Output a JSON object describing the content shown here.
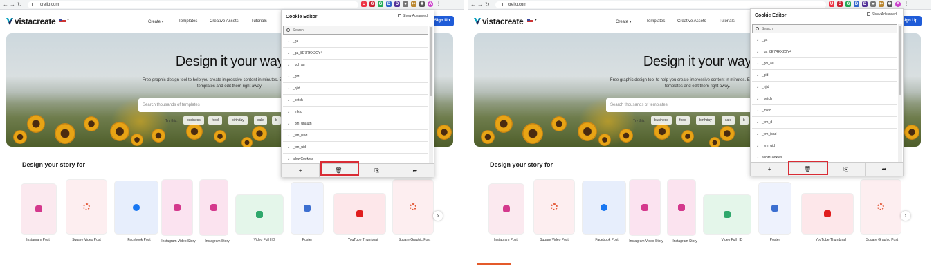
{
  "browser": {
    "url": "crello.com"
  },
  "site": {
    "logo": "vistacreate",
    "nav": [
      "Create",
      "Templates",
      "Creative Assets",
      "Tutorials"
    ],
    "signup": "Sign Up"
  },
  "hero": {
    "title": "Design it your way",
    "subtitle": "Free graphic design tool to help you create impressive content in minutes. Explore professional templates and edit them right away.",
    "search_placeholder": "Search thousands of templates",
    "try_label": "Try this:",
    "chips": [
      "business",
      "food",
      "birthday",
      "sale",
      "b"
    ]
  },
  "section": {
    "title": "Design your story for",
    "cards": [
      {
        "label": "Instagram Post",
        "icon": "instagram-icon"
      },
      {
        "label": "Square Video Post",
        "icon": "spinner-icon"
      },
      {
        "label": "Facebook Post",
        "icon": "facebook-icon"
      },
      {
        "label": "Instagram Video Story",
        "icon": "instagram-icon"
      },
      {
        "label": "Instagram Story",
        "icon": "instagram-icon"
      },
      {
        "label": "Video Full HD",
        "icon": "play-icon"
      },
      {
        "label": "Poster",
        "icon": "poster-icon"
      },
      {
        "label": "YouTube Thumbnail",
        "icon": "youtube-icon"
      },
      {
        "label": "Square Graphic Post",
        "icon": "spinner-icon"
      }
    ]
  },
  "cookie_editor": {
    "title": "Cookie Editor",
    "show_advanced": "Show Advanced",
    "search_placeholder": "Search",
    "left_rows": [
      "_ga",
      "_ga_8E7RKX2GY4",
      "_gcl_au",
      "_gid",
      "_hjid",
      "_ketch",
      "_mkto",
      "_pin_unauth",
      "_ym_isad",
      "_ym_uid",
      "allowCookies"
    ],
    "right_rows": [
      "_ga",
      "_ga_8E7RKX2GY4",
      "_gcl_au",
      "_gid",
      "_hjid",
      "_ketch",
      "_mkto",
      "_ym_d",
      "_ym_isad",
      "_ym_uid",
      "allowCookies"
    ],
    "toolbar": [
      {
        "name": "add-cookie-button",
        "glyph": "+"
      },
      {
        "name": "delete-all-button",
        "glyph": "🗑"
      },
      {
        "name": "import-button",
        "glyph": "⎘"
      },
      {
        "name": "export-button",
        "glyph": "➦"
      }
    ]
  },
  "colors": {
    "highlight": "#d92c35",
    "signup": "#1f5cd8"
  }
}
